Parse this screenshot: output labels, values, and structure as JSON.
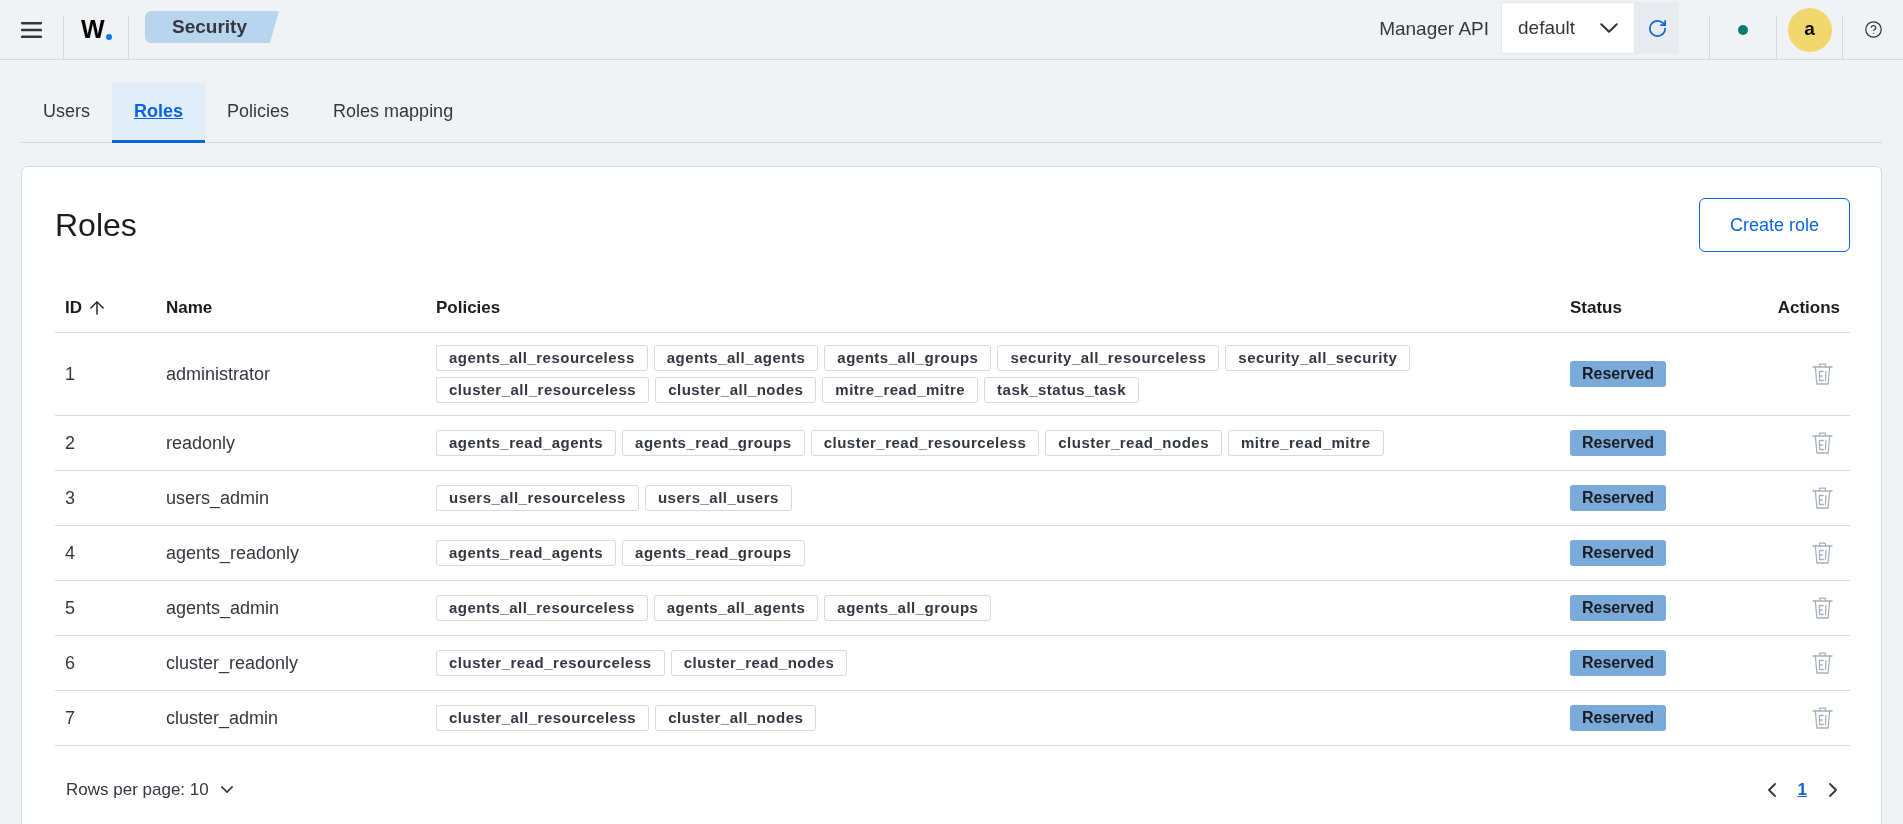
{
  "header": {
    "logo": "W",
    "breadcrumb": "Security",
    "api_label": "Manager API",
    "api_select": {
      "value": "default"
    },
    "avatar": "a"
  },
  "tabs": [
    {
      "label": "Users",
      "selected": false
    },
    {
      "label": "Roles",
      "selected": true
    },
    {
      "label": "Policies",
      "selected": false
    },
    {
      "label": "Roles mapping",
      "selected": false
    }
  ],
  "panel": {
    "title": "Roles",
    "create_button": "Create role"
  },
  "table": {
    "columns": [
      {
        "label": "ID",
        "sorted": true
      },
      {
        "label": "Name",
        "sorted": false
      },
      {
        "label": "Policies",
        "sorted": false
      },
      {
        "label": "Status",
        "sorted": false
      },
      {
        "label": "Actions",
        "sorted": false
      }
    ],
    "rows": [
      {
        "id": "1",
        "name": "administrator",
        "policies": [
          "agents_all_resourceless",
          "agents_all_agents",
          "agents_all_groups",
          "security_all_resourceless",
          "security_all_security",
          "cluster_all_resourceless",
          "cluster_all_nodes",
          "mitre_read_mitre",
          "task_status_task"
        ],
        "status": "Reserved"
      },
      {
        "id": "2",
        "name": "readonly",
        "policies": [
          "agents_read_agents",
          "agents_read_groups",
          "cluster_read_resourceless",
          "cluster_read_nodes",
          "mitre_read_mitre"
        ],
        "status": "Reserved"
      },
      {
        "id": "3",
        "name": "users_admin",
        "policies": [
          "users_all_resourceless",
          "users_all_users"
        ],
        "status": "Reserved"
      },
      {
        "id": "4",
        "name": "agents_readonly",
        "policies": [
          "agents_read_agents",
          "agents_read_groups"
        ],
        "status": "Reserved"
      },
      {
        "id": "5",
        "name": "agents_admin",
        "policies": [
          "agents_all_resourceless",
          "agents_all_agents",
          "agents_all_groups"
        ],
        "status": "Reserved"
      },
      {
        "id": "6",
        "name": "cluster_readonly",
        "policies": [
          "cluster_read_resourceless",
          "cluster_read_nodes"
        ],
        "status": "Reserved"
      },
      {
        "id": "7",
        "name": "cluster_admin",
        "policies": [
          "cluster_all_resourceless",
          "cluster_all_nodes"
        ],
        "status": "Reserved"
      }
    ]
  },
  "pagination": {
    "rows_per_page": "Rows per page: 10",
    "pages": [
      {
        "label": "1",
        "selected": true
      }
    ]
  }
}
